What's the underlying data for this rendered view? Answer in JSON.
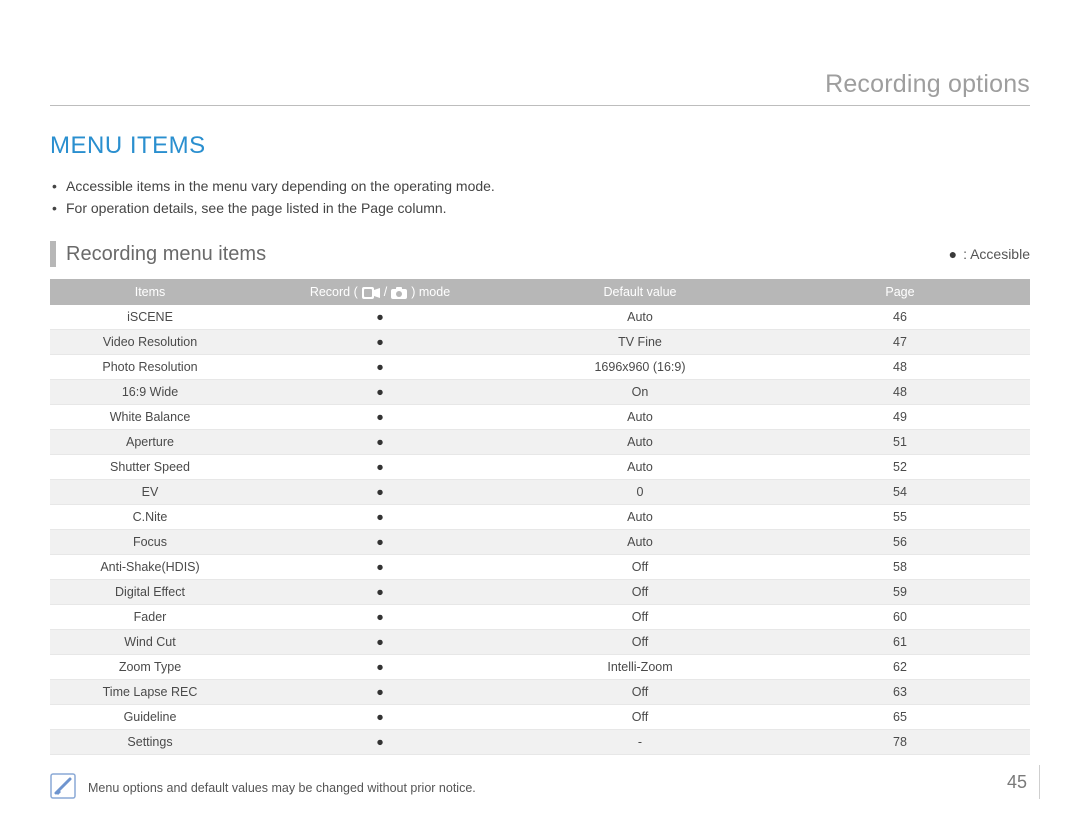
{
  "chapterTitle": "Recording options",
  "sectionTitle": "MENU ITEMS",
  "intro": [
    "Accessible items in the menu vary depending on the operating mode.",
    "For operation details, see the page listed in the Page column."
  ],
  "subheading": "Recording menu items",
  "legend": {
    "symbol": "●",
    "label": ": Accesible"
  },
  "table": {
    "headers": {
      "items": "Items",
      "modePrefix": "Record (",
      "modeSeparator": " / ",
      "modeSuffix": ") mode",
      "default": "Default value",
      "page": "Page"
    },
    "rows": [
      {
        "item": "iSCENE",
        "mode": "●",
        "default": "Auto",
        "page": "46"
      },
      {
        "item": "Video Resolution",
        "mode": "●",
        "default": "TV Fine",
        "page": "47"
      },
      {
        "item": "Photo Resolution",
        "mode": "●",
        "default": "1696x960 (16:9)",
        "page": "48"
      },
      {
        "item": "16:9 Wide",
        "mode": "●",
        "default": "On",
        "page": "48"
      },
      {
        "item": "White Balance",
        "mode": "●",
        "default": "Auto",
        "page": "49"
      },
      {
        "item": "Aperture",
        "mode": "●",
        "default": "Auto",
        "page": "51"
      },
      {
        "item": "Shutter Speed",
        "mode": "●",
        "default": "Auto",
        "page": "52"
      },
      {
        "item": "EV",
        "mode": "●",
        "default": "0",
        "page": "54"
      },
      {
        "item": "C.Nite",
        "mode": "●",
        "default": "Auto",
        "page": "55"
      },
      {
        "item": "Focus",
        "mode": "●",
        "default": "Auto",
        "page": "56"
      },
      {
        "item": "Anti-Shake(HDIS)",
        "mode": "●",
        "default": "Off",
        "page": "58"
      },
      {
        "item": "Digital Effect",
        "mode": "●",
        "default": "Off",
        "page": "59"
      },
      {
        "item": "Fader",
        "mode": "●",
        "default": "Off",
        "page": "60"
      },
      {
        "item": "Wind Cut",
        "mode": "●",
        "default": "Off",
        "page": "61"
      },
      {
        "item": "Zoom Type",
        "mode": "●",
        "default": "Intelli-Zoom",
        "page": "62"
      },
      {
        "item": "Time Lapse REC",
        "mode": "●",
        "default": "Off",
        "page": "63"
      },
      {
        "item": "Guideline",
        "mode": "●",
        "default": "Off",
        "page": "65"
      },
      {
        "item": "Settings",
        "mode": "●",
        "default": "-",
        "page": "78"
      }
    ]
  },
  "note": "Menu options and default values may be changed without prior notice.",
  "pageNumber": "45"
}
